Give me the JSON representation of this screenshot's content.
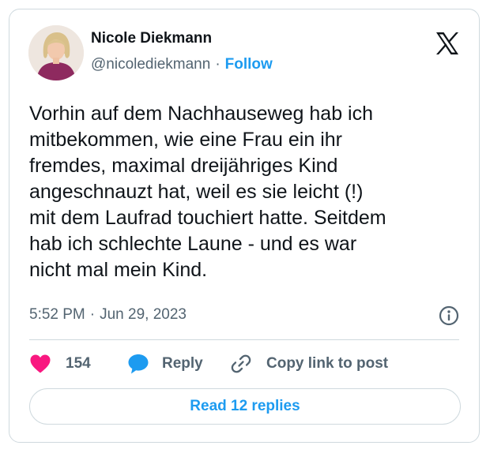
{
  "author": {
    "name": "Nicole Diekmann",
    "handle": "@nicolediekmann",
    "separator": "·",
    "follow_label": "Follow"
  },
  "tweet": {
    "text": "Vorhin auf dem Nachhauseweg hab ich\nmitbekommen, wie eine Frau ein ihr\nfremdes, maximal dreijähriges Kind\nangeschnauzt hat, weil es sie leicht (!)\nmit dem Laufrad touchiert hatte. Seitdem\nhab ich schlechte Laune - und es war\nnicht mal mein Kind.",
    "time": "5:52 PM",
    "separator": "·",
    "date": "Jun 29, 2023"
  },
  "actions": {
    "like_count": "154",
    "reply_label": "Reply",
    "copy_label": "Copy link to post"
  },
  "read_replies_label": "Read 12 replies",
  "icons": {
    "brand": "x-logo-icon",
    "info": "info-icon",
    "like": "heart-icon",
    "reply": "speech-bubble-icon",
    "copy": "link-icon"
  },
  "colors": {
    "accent": "#1d9bf0",
    "heart": "#f91880",
    "text": "#0f1419",
    "muted": "#536471",
    "border": "#cfd9de"
  }
}
